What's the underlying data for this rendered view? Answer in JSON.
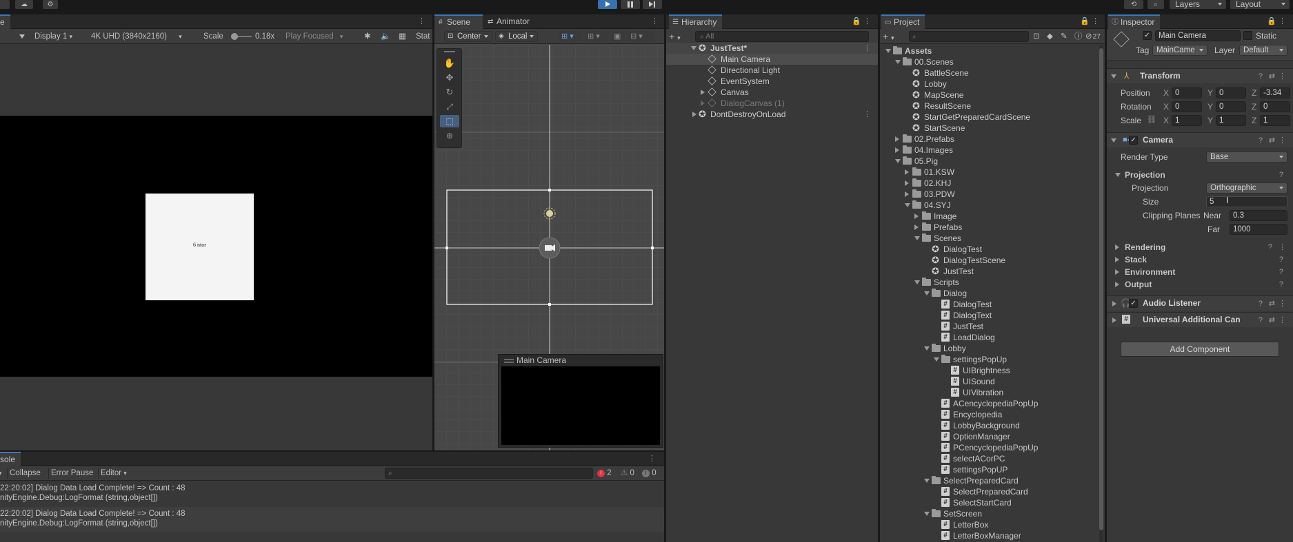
{
  "topbar": {
    "layers_label": "Layers",
    "layout_label": "Layout",
    "play_icon": "play-icon",
    "pause_icon": "pause-icon",
    "step_icon": "step-icon"
  },
  "game": {
    "tab_label": "e",
    "display": "Display 1",
    "resolution": "4K UHD (3840x2160)",
    "scale_label": "Scale",
    "scale_value": "0.18x",
    "play_mode": "Play Focused",
    "stats_label": "Stat",
    "card_text": "6 ntor"
  },
  "scene": {
    "tabs": [
      "Scene",
      "Animator"
    ],
    "pivot": "Center",
    "space": "Local",
    "camera_preview_title": "Main Camera"
  },
  "console": {
    "tab_label": "sole",
    "buttons": [
      "Collapse",
      "Error Pause",
      "Editor"
    ],
    "counts": {
      "errors": "2",
      "warnings": "0",
      "infos": "0"
    },
    "logs": [
      {
        "line1": "22:20:02] Dialog Data Load Complete! => Count : 48",
        "line2": "nityEngine.Debug:LogFormat (string,object[])"
      },
      {
        "line1": "22:20:02] Dialog Data Load Complete! => Count : 48",
        "line2": "nityEngine.Debug:LogFormat (string,object[])"
      }
    ]
  },
  "hierarchy": {
    "tab_label": "Hierarchy",
    "search_placeholder": "All",
    "scene_name": "JustTest*",
    "items": [
      "Main Camera",
      "Directional Light",
      "EventSystem",
      "Canvas",
      "DialogCanvas (1)"
    ],
    "dont_destroy": "DontDestroyOnLoad"
  },
  "project": {
    "tab_label": "Project",
    "badge_count": "27",
    "rows": [
      {
        "t": "Assets",
        "d": 0,
        "k": "folder",
        "a": "down",
        "b": true
      },
      {
        "t": "00.Scenes",
        "d": 1,
        "k": "folder",
        "a": "down"
      },
      {
        "t": "BattleScene",
        "d": 2,
        "k": "scene"
      },
      {
        "t": "Lobby",
        "d": 2,
        "k": "scene"
      },
      {
        "t": "MapScene",
        "d": 2,
        "k": "scene"
      },
      {
        "t": "ResultScene",
        "d": 2,
        "k": "scene"
      },
      {
        "t": "StartGetPreparedCardScene",
        "d": 2,
        "k": "scene"
      },
      {
        "t": "StartScene",
        "d": 2,
        "k": "scene"
      },
      {
        "t": "02.Prefabs",
        "d": 1,
        "k": "folder",
        "a": "right"
      },
      {
        "t": "04.Images",
        "d": 1,
        "k": "folder",
        "a": "right"
      },
      {
        "t": "05.Pig",
        "d": 1,
        "k": "folder",
        "a": "down"
      },
      {
        "t": "01.KSW",
        "d": 2,
        "k": "folder",
        "a": "right"
      },
      {
        "t": "02.KHJ",
        "d": 2,
        "k": "folder",
        "a": "right"
      },
      {
        "t": "03.PDW",
        "d": 2,
        "k": "folder",
        "a": "right"
      },
      {
        "t": "04.SYJ",
        "d": 2,
        "k": "folder",
        "a": "down"
      },
      {
        "t": "Image",
        "d": 3,
        "k": "folder",
        "a": "right"
      },
      {
        "t": "Prefabs",
        "d": 3,
        "k": "folder",
        "a": "right"
      },
      {
        "t": "Scenes",
        "d": 3,
        "k": "folder",
        "a": "down"
      },
      {
        "t": "DialogTest",
        "d": 4,
        "k": "scene"
      },
      {
        "t": "DialogTestScene",
        "d": 4,
        "k": "scene"
      },
      {
        "t": "JustTest",
        "d": 4,
        "k": "scene"
      },
      {
        "t": "Scripts",
        "d": 3,
        "k": "folder",
        "a": "down"
      },
      {
        "t": "Dialog",
        "d": 4,
        "k": "folder",
        "a": "down"
      },
      {
        "t": "DialogTest",
        "d": 5,
        "k": "script"
      },
      {
        "t": "DialogText",
        "d": 5,
        "k": "script"
      },
      {
        "t": "JustTest",
        "d": 5,
        "k": "script"
      },
      {
        "t": "LoadDialog",
        "d": 5,
        "k": "script"
      },
      {
        "t": "Lobby",
        "d": 4,
        "k": "folder",
        "a": "down"
      },
      {
        "t": "settingsPopUp",
        "d": 5,
        "k": "folder",
        "a": "down"
      },
      {
        "t": "UIBrightness",
        "d": 6,
        "k": "script"
      },
      {
        "t": "UISound",
        "d": 6,
        "k": "script"
      },
      {
        "t": "UIVibration",
        "d": 6,
        "k": "script"
      },
      {
        "t": "ACencyclopediaPopUp",
        "d": 5,
        "k": "script"
      },
      {
        "t": "Encyclopedia",
        "d": 5,
        "k": "script"
      },
      {
        "t": "LobbyBackground",
        "d": 5,
        "k": "script"
      },
      {
        "t": "OptionManager",
        "d": 5,
        "k": "script"
      },
      {
        "t": "PCencyclopediaPopUp",
        "d": 5,
        "k": "script"
      },
      {
        "t": "selectACorPC",
        "d": 5,
        "k": "script"
      },
      {
        "t": "settingsPopUP",
        "d": 5,
        "k": "script"
      },
      {
        "t": "SelectPreparedCard",
        "d": 4,
        "k": "folder",
        "a": "down"
      },
      {
        "t": "SelectPreparedCard",
        "d": 5,
        "k": "script"
      },
      {
        "t": "SelectStartCard",
        "d": 5,
        "k": "script"
      },
      {
        "t": "SetScreen",
        "d": 4,
        "k": "folder",
        "a": "down"
      },
      {
        "t": "LetterBox",
        "d": 5,
        "k": "script"
      },
      {
        "t": "LetterBoxManager",
        "d": 5,
        "k": "script"
      }
    ]
  },
  "inspector": {
    "tab_label": "Inspector",
    "object_name": "Main Camera",
    "static_label": "Static",
    "tag_label": "Tag",
    "tag_value": "MainCame",
    "layer_label": "Layer",
    "layer_value": "Default",
    "transform": {
      "title": "Transform",
      "position_label": "Position",
      "rotation_label": "Rotation",
      "scale_label": "Scale",
      "position": {
        "x": "0",
        "y": "0",
        "z": "-3.34"
      },
      "rotation": {
        "x": "0",
        "y": "0",
        "z": "0"
      },
      "scale": {
        "x": "1",
        "y": "1",
        "z": "1"
      }
    },
    "camera": {
      "title": "Camera",
      "render_type_label": "Render Type",
      "render_type": "Base",
      "projection_header": "Projection",
      "projection_label": "Projection",
      "projection_value": "Orthographic",
      "size_label": "Size",
      "size_value": "5",
      "clipping_label": "Clipping Planes",
      "near_label": "Near",
      "near_value": "0.3",
      "far_label": "Far",
      "far_value": "1000",
      "sections": [
        "Rendering",
        "Stack",
        "Environment",
        "Output"
      ]
    },
    "audio_listener": "Audio Listener",
    "urp_camera": "Universal Additional Can",
    "add_component": "Add Component"
  }
}
